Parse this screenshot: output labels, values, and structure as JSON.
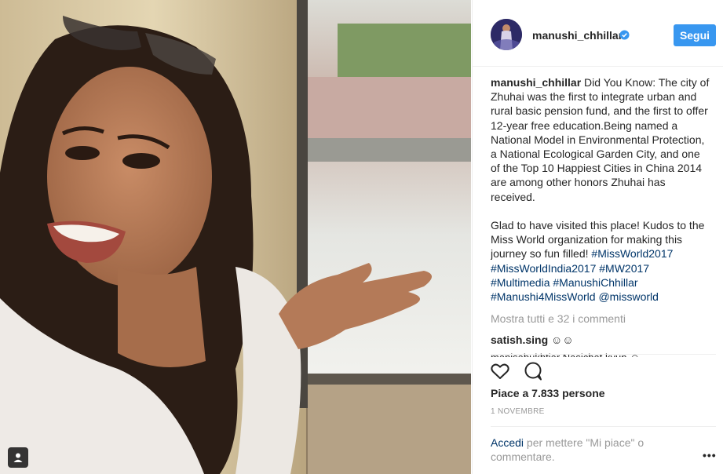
{
  "post": {
    "username": "manushi_chhillar",
    "follow_label": "Segui",
    "caption_user": "manushi_chhillar",
    "caption_text_1": "Did You Know: The city of Zhuhai was the first to integrate urban and rural basic pension fund, and the first to offer 12-year free education.Being named a National Model in Environmental Protection, a National Ecological Garden City, and one of the Top 10 Happiest Cities in China 2014 are among other honors Zhuhai has received.",
    "caption_text_2": "Glad to have visited this place! Kudos to the Miss World organization for making this journey so fun filled! ",
    "hashtags": [
      "#MissWorld2017",
      "#MissWorldIndia2017",
      "#MW2017",
      "#Multimedia",
      "#ManushiChhillar",
      "#Manushi4MissWorld"
    ],
    "mention": "@missworld",
    "view_all_comments": "Mostra tutti e 32 i commenti",
    "comments": [
      {
        "user": "satish.sing",
        "text": "☺☺"
      }
    ],
    "partial_comment": "manisabukhtiar  Nasichat kyun ☺",
    "likes": "Piace a 7.833 persone",
    "date": "1 NOVEMBRE",
    "login_link": "Accedi",
    "login_rest": " per mettere \"Mi piace\" o commentare.",
    "more_label": "•••"
  },
  "icons": {
    "like": "heart-outline-icon",
    "comment": "speech-bubble-icon",
    "verified": "verified-badge-icon",
    "tag": "user-tag-icon",
    "more": "ellipsis-icon"
  },
  "colors": {
    "follow_button": "#3897f0",
    "link": "#003569",
    "muted": "#999999",
    "text": "#262626"
  }
}
